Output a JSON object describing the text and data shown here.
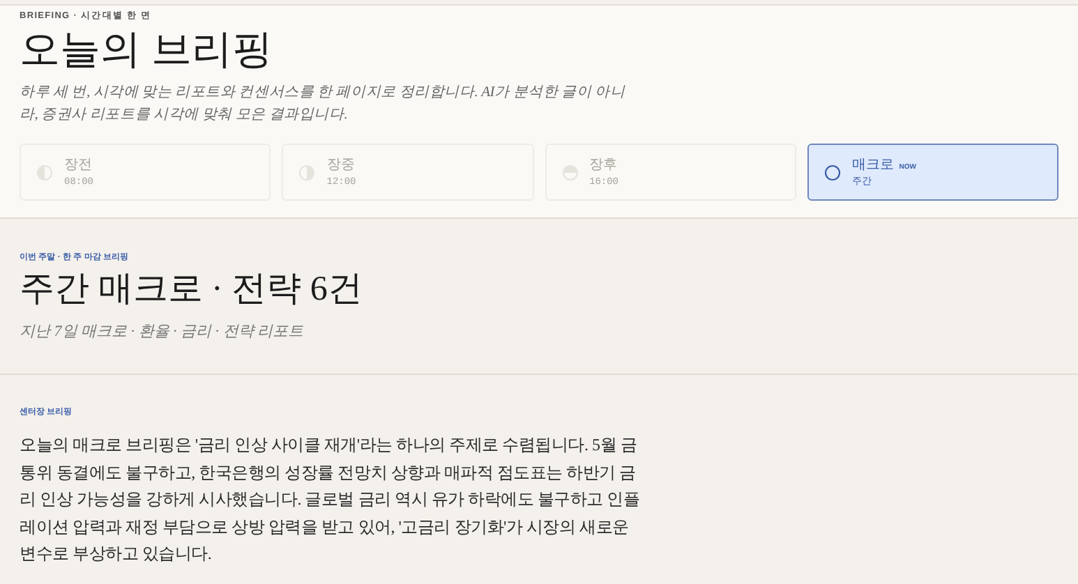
{
  "header": {
    "eyebrow": "BRIEFING · 시간대별 한 면",
    "title": "오늘의 브리핑",
    "description": "하루 세 번, 시각에 맞는 리포트와 컨센서스를 한 페이지로 정리합니다. AI가 분석한 글이 아니라, 증권사 리포트를 시각에 맞춰 모은 결과입니다."
  },
  "sessions": [
    {
      "kind": "left-half",
      "label": "장전",
      "time": "08:00",
      "selected": false
    },
    {
      "kind": "right-half",
      "label": "장중",
      "time": "12:00",
      "selected": false
    },
    {
      "kind": "top-half",
      "label": "장후",
      "time": "16:00",
      "selected": false
    },
    {
      "kind": "ring",
      "label": "매크로",
      "badge": "NOW",
      "time": "주간",
      "selected": true
    }
  ],
  "weekly": {
    "eyebrow": "이번 주말 · 한 주 마감 브리핑",
    "title": "주간 매크로 · 전략 6건",
    "subtitle": "지난 7일 매크로 · 환율 · 금리 · 전략 리포트"
  },
  "center": {
    "eyebrow": "센터장 브리핑",
    "body": "오늘의 매크로 브리핑은 '금리 인상 사이클 재개'라는 하나의 주제로 수렴됩니다. 5월 금통위 동결에도 불구하고, 한국은행의 성장률 전망치 상향과 매파적 점도표는 하반기 금리 인상 가능성을 강하게 시사했습니다. 글로벌 금리 역시 유가 하락에도 불구하고 인플레이션 압력과 재정 부담으로 상방 압력을 받고 있어, '고금리 장기화'가 시장의 새로운 변수로 부상하고 있습니다."
  }
}
